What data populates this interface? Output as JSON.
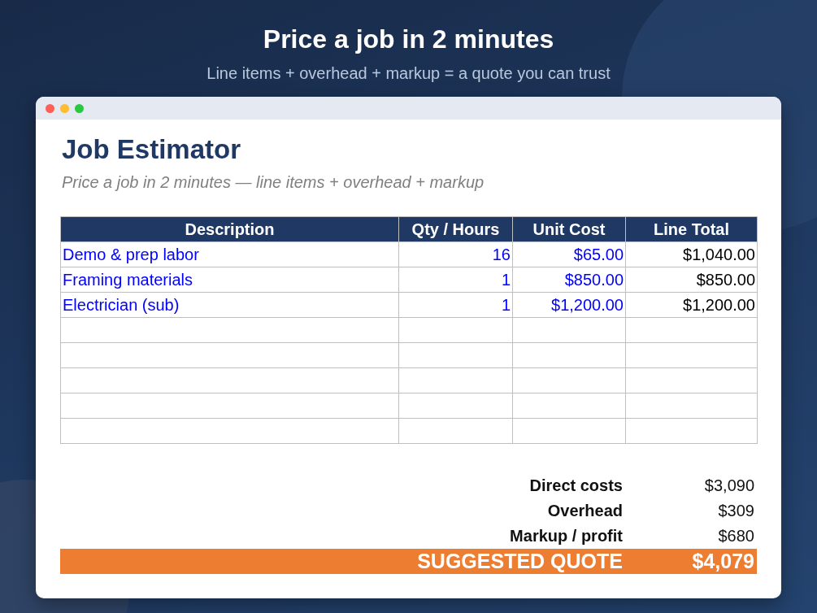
{
  "headline": {
    "title": "Price a job in 2 minutes",
    "subtitle": "Line items + overhead + markup = a quote you can trust"
  },
  "window": {
    "title": "Job Estimator",
    "subtitle": "Price a job in 2 minutes — line items + overhead + markup"
  },
  "table": {
    "columns": [
      {
        "label": "Description",
        "kind": "text-input"
      },
      {
        "label": "Qty / Hours",
        "kind": "number-input"
      },
      {
        "label": "Unit Cost",
        "kind": "number-input"
      },
      {
        "label": "Line Total",
        "kind": "formula"
      }
    ],
    "rows": [
      {
        "kind": "item",
        "cells": [
          "Demo & prep labor",
          "16",
          "$65.00",
          "$1,040.00"
        ]
      },
      {
        "kind": "item",
        "cells": [
          "Framing materials",
          "1",
          "$850.00",
          "$850.00"
        ]
      },
      {
        "kind": "item",
        "cells": [
          "Electrician (sub)",
          "1",
          "$1,200.00",
          "$1,200.00"
        ]
      },
      {
        "kind": "blank"
      },
      {
        "kind": "blank"
      },
      {
        "kind": "blank"
      },
      {
        "kind": "blank"
      },
      {
        "kind": "blank"
      }
    ]
  },
  "summary": [
    {
      "label": "Direct costs",
      "value": "$3,090",
      "kind": "line"
    },
    {
      "label": "Overhead",
      "value": "$309",
      "kind": "line"
    },
    {
      "label": "Markup / profit",
      "value": "$680",
      "kind": "line"
    },
    {
      "label": "SUGGESTED QUOTE",
      "value": "$4,079",
      "kind": "total"
    }
  ]
}
